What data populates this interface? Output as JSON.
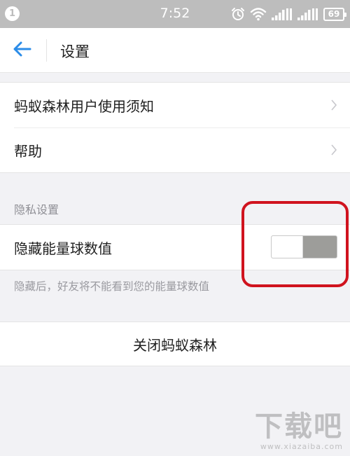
{
  "status_bar": {
    "notification_count": "1",
    "time": "7:52",
    "battery": "69",
    "icons": [
      "alarm-icon",
      "wifi-icon",
      "signal-icon",
      "signal-icon",
      "battery-icon"
    ]
  },
  "header": {
    "title": "设置",
    "back_icon": "arrow-left-icon"
  },
  "menu": {
    "items": [
      {
        "label": "蚂蚁森林用户使用须知"
      },
      {
        "label": "帮助"
      }
    ]
  },
  "privacy": {
    "section_label": "隐私设置",
    "hide_energy_label": "隐藏能量球数值",
    "hide_energy_enabled": false,
    "hint": "隐藏后，好友将不能看到您的能量球数值"
  },
  "close_forest_label": "关闭蚂蚁森林",
  "watermark": {
    "main": "下载吧",
    "sub": "www.xiazaiba.com"
  },
  "colors": {
    "status_bar": "#bdbdbd",
    "accent": "#2b8ce8",
    "highlight": "#d0131e",
    "toggle_off_track": "#9d9d9a"
  }
}
